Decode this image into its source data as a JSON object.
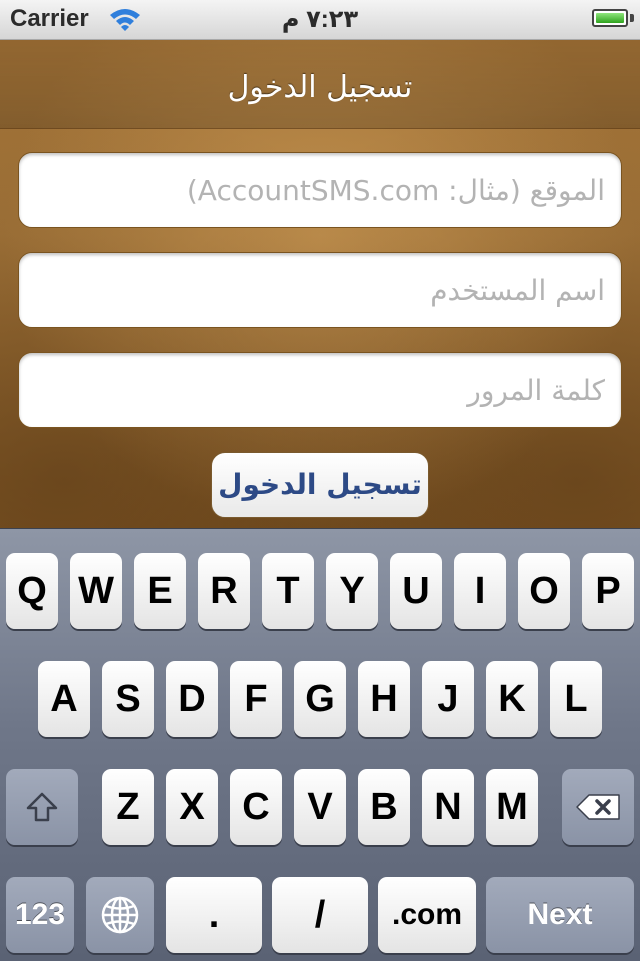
{
  "status_bar": {
    "carrier": "Carrier",
    "time": "٧:٢٣ م",
    "battery_level": 1.0
  },
  "nav": {
    "title": "تسجيل الدخول"
  },
  "form": {
    "site_placeholder": "الموقع (مثال: AccountSMS.com)",
    "username_placeholder": "اسم المستخدم",
    "password_placeholder": "كلمة المرور",
    "login_label": "تسجيل الدخول"
  },
  "keyboard": {
    "row1": [
      "Q",
      "W",
      "E",
      "R",
      "T",
      "Y",
      "U",
      "I",
      "O",
      "P"
    ],
    "row2": [
      "A",
      "S",
      "D",
      "F",
      "G",
      "H",
      "J",
      "K",
      "L"
    ],
    "row3": [
      "Z",
      "X",
      "C",
      "V",
      "B",
      "N",
      "M"
    ],
    "numbers_label": "123",
    "dot_label": ".",
    "slash_label": "/",
    "dotcom_label": ".com",
    "next_label": "Next"
  }
}
